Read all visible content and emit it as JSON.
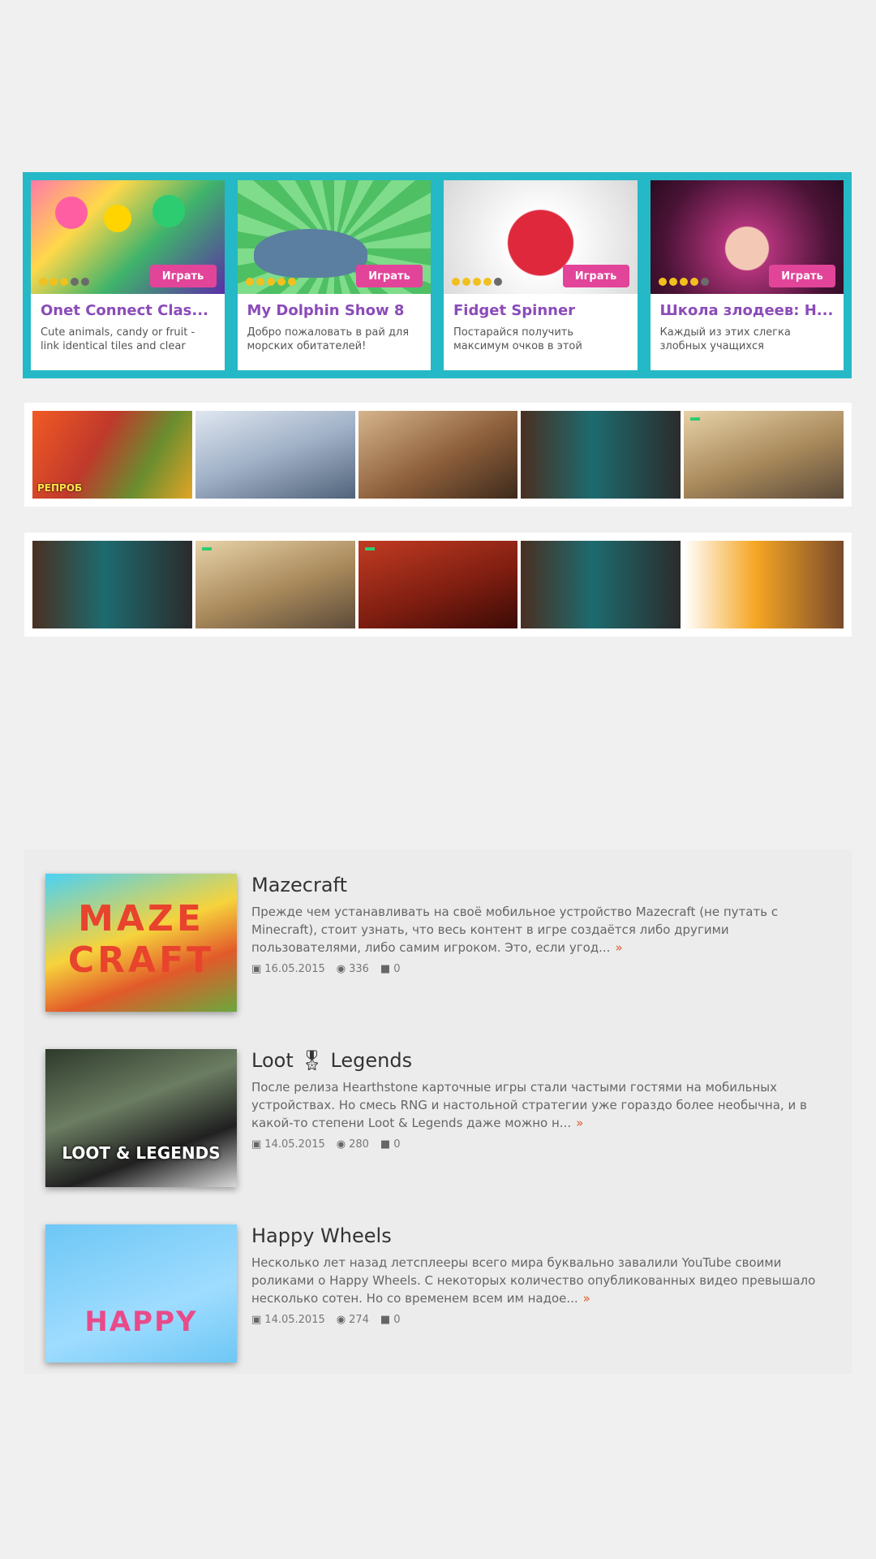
{
  "games": [
    {
      "title": "Onet Connect Clas...",
      "desc": "Cute animals, candy or fruit - link identical tiles and clear",
      "play": "Играть",
      "rating": 3
    },
    {
      "title": "My Dolphin Show 8",
      "desc": "Добро пожаловать в рай для морских обитателей!",
      "play": "Играть",
      "rating": 5
    },
    {
      "title": "Fidget Spinner",
      "desc": "Постарайся получить максимум очков в этой",
      "play": "Играть",
      "rating": 4
    },
    {
      "title": "Школа злодеев: Н...",
      "desc": "Каждый из этих слегка злобных учащихся",
      "play": "Играть",
      "rating": 4
    }
  ],
  "promos": {
    "row1": [
      {
        "name": "promo-ogre",
        "caption": "РЕПРОБ"
      },
      {
        "name": "promo-ship",
        "caption": ""
      },
      {
        "name": "promo-brown",
        "caption": ""
      },
      {
        "name": "promo-teal",
        "caption": ""
      },
      {
        "name": "promo-sand",
        "caption": ""
      }
    ],
    "row2": [
      {
        "name": "promo-teal",
        "caption": ""
      },
      {
        "name": "promo-sand",
        "caption": ""
      },
      {
        "name": "promo-red",
        "caption": ""
      },
      {
        "name": "promo-teal",
        "caption": ""
      },
      {
        "name": "promo-orange",
        "caption": ""
      }
    ]
  },
  "articles": [
    {
      "title": "Mazecraft",
      "text": "Прежде чем устанавливать на своё мобильное устройство Mazecraft (не путать с Minecraft), стоит узнать, что весь контент в игре создаётся либо другими пользователями, либо самим игроком. Это, если угод...",
      "date": "16.05.2015",
      "views": "336",
      "comments": "0",
      "image_word": "MAZE CRAFT"
    },
    {
      "title": "Loot 🎖 Legends",
      "text": "После релиза Hearthstone карточные игры стали частыми гостями на мобильных устройствах. Но смесь RNG и настольной стратегии уже гораздо более необычна, и в какой-то степени Loot & Legends даже можно н...",
      "date": "14.05.2015",
      "views": "280",
      "comments": "0",
      "image_word": "LOOT & LEGENDS"
    },
    {
      "title": "Happy Wheels",
      "text": "Несколько лет назад летсплееры всего мира буквально завалили YouTube своими роликами о Happy Wheels. С некоторых количество опубликованных видео превышало несколько сотен. Но со временем всем им надое...",
      "date": "14.05.2015",
      "views": "274",
      "comments": "0",
      "image_word": "HAPPY"
    }
  ],
  "colors": {
    "strip": "#25b8c6",
    "play_button": "#e2449a",
    "game_title": "#8b4bb8",
    "accent_arrow": "#e25a2a"
  },
  "icons": {
    "date": "calendar-icon",
    "views": "eye-icon",
    "comments": "comment-icon",
    "more": "arrow-right-icon"
  }
}
